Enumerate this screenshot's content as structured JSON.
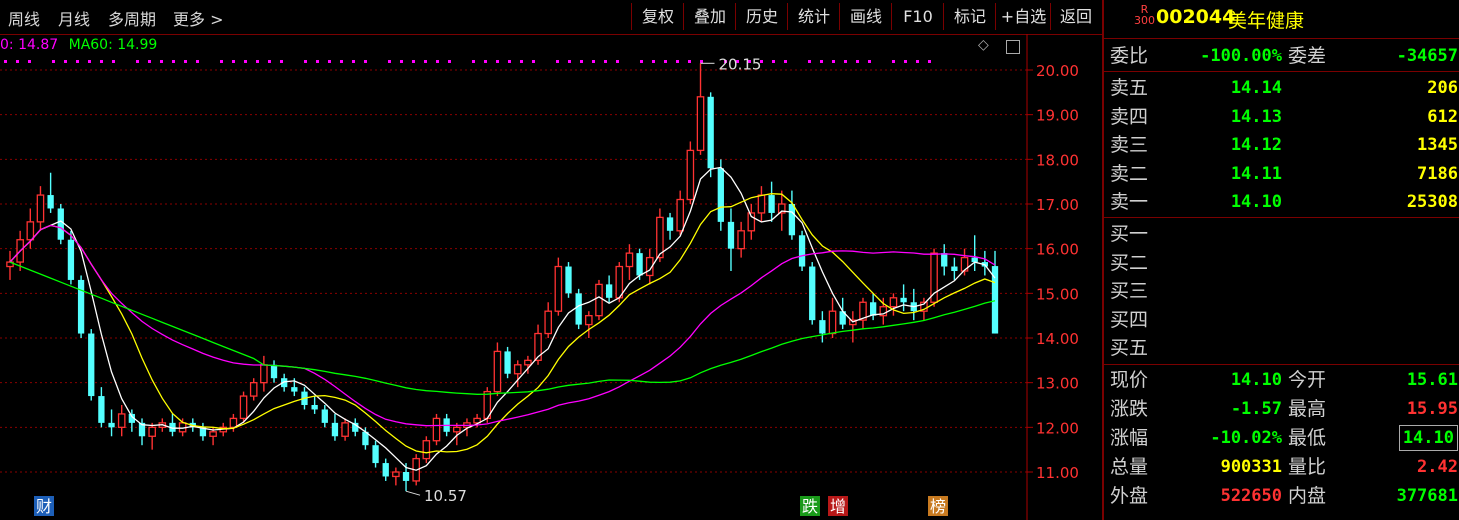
{
  "toolbar": {
    "left_items": [
      "周线",
      "月线",
      "多周期",
      "更多 >"
    ],
    "buttons": [
      "复权",
      "叠加",
      "历史",
      "统计",
      "画线",
      "F10",
      "标记",
      "+自选",
      "返回"
    ]
  },
  "ma_legend": {
    "ma30": "0: 14.87",
    "ma60": "MA60: 14.99"
  },
  "chart_data": {
    "type": "candlestick",
    "ylim": [
      10.6,
      20.4
    ],
    "y_ticks": [
      "20.00",
      "19.00",
      "18.00",
      "17.00",
      "16.00",
      "15.00",
      "14.00",
      "13.00",
      "12.00",
      "11.00"
    ],
    "high_label": "20.15",
    "low_label": "10.57",
    "event_markers": [
      "财",
      "跌",
      "增",
      "榜"
    ],
    "colors": {
      "up": "#ff3232",
      "down": "#54ffff",
      "ma5": "#ffffff",
      "ma10": "#ffff00",
      "ma30": "#ff00ff",
      "ma60": "#00ff00"
    }
  },
  "panel": {
    "badge_top": "R",
    "badge_bottom": "300",
    "code": "002044",
    "name": "美年健康",
    "weibi_label": "委比",
    "weibi_value": "-100.00%",
    "weicha_label": "委差",
    "weicha_value": "-34657",
    "sells": [
      {
        "label": "卖五",
        "price": "14.14",
        "vol": "206"
      },
      {
        "label": "卖四",
        "price": "14.13",
        "vol": "612"
      },
      {
        "label": "卖三",
        "price": "14.12",
        "vol": "1345"
      },
      {
        "label": "卖二",
        "price": "14.11",
        "vol": "7186"
      },
      {
        "label": "卖一",
        "price": "14.10",
        "vol": "25308"
      }
    ],
    "buys": [
      {
        "label": "买一"
      },
      {
        "label": "买二"
      },
      {
        "label": "买三"
      },
      {
        "label": "买四"
      },
      {
        "label": "买五"
      }
    ],
    "stats": [
      {
        "l1": "现价",
        "v1": "14.10",
        "l2": "今开",
        "v2": "15.61"
      },
      {
        "l1": "涨跌",
        "v1": "-1.57",
        "l2": "最高",
        "v2": "15.95"
      },
      {
        "l1": "涨幅",
        "v1": "-10.02%",
        "l2": "最低",
        "v2": "14.10"
      },
      {
        "l1": "总量",
        "v1": "900331",
        "l2": "量比",
        "v2": "2.42"
      },
      {
        "l1": "外盘",
        "v1": "522650",
        "l2": "内盘",
        "v2": "377681"
      }
    ]
  }
}
